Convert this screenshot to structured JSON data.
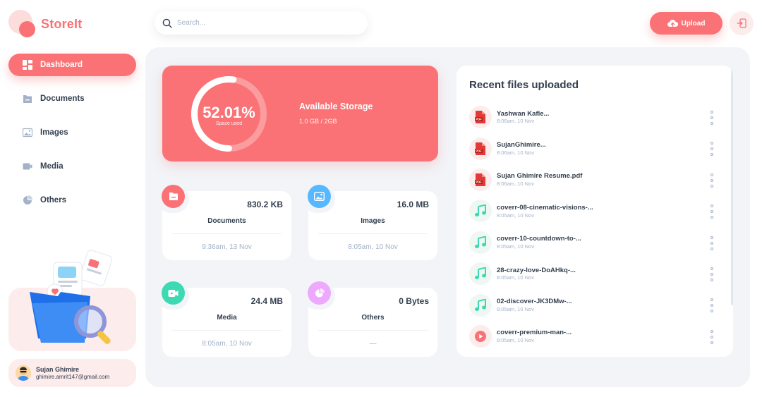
{
  "app": {
    "name": "StoreIt"
  },
  "sidebar": {
    "items": [
      {
        "label": "Dashboard",
        "icon": "dashboard-icon",
        "active": true
      },
      {
        "label": "Documents",
        "icon": "documents-icon",
        "active": false
      },
      {
        "label": "Images",
        "icon": "images-icon",
        "active": false
      },
      {
        "label": "Media",
        "icon": "media-icon",
        "active": false
      },
      {
        "label": "Others",
        "icon": "others-icon",
        "active": false
      }
    ]
  },
  "user": {
    "name": "Sujan Ghimire",
    "email": "ghimire.amrit147@gmail.com"
  },
  "search": {
    "placeholder": "Search..."
  },
  "header": {
    "upload_label": "Upload"
  },
  "storage": {
    "percent_label": "52.01%",
    "percent_value": 52.01,
    "subtitle": "Space used",
    "title": "Available Storage",
    "usage": "1.0 GB / 2GB"
  },
  "categories": [
    {
      "title": "Documents",
      "size": "830.2 KB",
      "date": "9:36am, 13 Nov",
      "color": "#FA7275",
      "icon": "folder-icon"
    },
    {
      "title": "Images",
      "size": "16.0 MB",
      "date": "8:05am, 10 Nov",
      "color": "#56B8FF",
      "icon": "image-icon"
    },
    {
      "title": "Media",
      "size": "24.4 MB",
      "date": "8:05am, 10 Nov",
      "color": "#3DD9B3",
      "icon": "video-icon"
    },
    {
      "title": "Others",
      "size": "0 Bytes",
      "date": "—",
      "color": "#EEA8FD",
      "icon": "pie-icon"
    }
  ],
  "recent": {
    "title": "Recent files uploaded",
    "files": [
      {
        "name": "Yashwan Kafle...",
        "date": "8:06am, 10 Nov",
        "type": "pdf"
      },
      {
        "name": "SujanGhimire...",
        "date": "8:06am, 10 Nov",
        "type": "pdf"
      },
      {
        "name": "Sujan Ghimire Resume.pdf",
        "date": "8:06am, 10 Nov",
        "type": "pdf"
      },
      {
        "name": "coverr-08-cinematic-visions-...",
        "date": "8:05am, 10 Nov",
        "type": "audio"
      },
      {
        "name": "coverr-10-countdown-to-...",
        "date": "8:05am, 10 Nov",
        "type": "audio"
      },
      {
        "name": "28-crazy-love-DoAHkq-...",
        "date": "8:05am, 10 Nov",
        "type": "audio"
      },
      {
        "name": "02-discover-JK3DMw-...",
        "date": "8:05am, 10 Nov",
        "type": "audio"
      },
      {
        "name": "coverr-premium-man-...",
        "date": "8:05am, 10 Nov",
        "type": "video"
      }
    ]
  }
}
